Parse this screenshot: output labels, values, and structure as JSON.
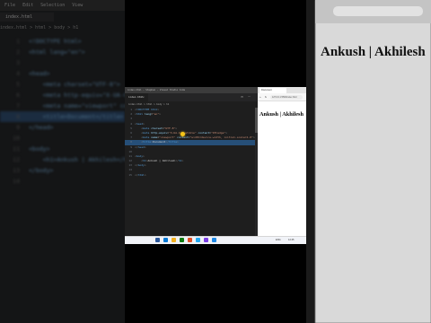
{
  "editor": {
    "title": "index.html - Stephen - Visual Studio Code",
    "tab_label": "index.html",
    "tab_close": "×",
    "breadcrumb": "index.html > html > body > h1",
    "menu": [
      "File",
      "Edit",
      "Selection",
      "View"
    ],
    "code_lines": [
      {
        "n": "1",
        "html": "<span class='p'>&lt;</span><span class='t'>!DOCTYPE html</span><span class='p'>&gt;</span>"
      },
      {
        "n": "2",
        "html": "<span class='p'>&lt;</span><span class='t'>html</span> <span class='a'>lang</span><span class='x'>=</span><span class='s'>\"en\"</span><span class='p'>&gt;</span>"
      },
      {
        "n": "3",
        "html": ""
      },
      {
        "n": "4",
        "html": "<span class='p'>&lt;</span><span class='t'>head</span><span class='p'>&gt;</span>"
      },
      {
        "n": "5",
        "html": "    <span class='p'>&lt;</span><span class='t'>meta</span> <span class='a'>charset</span><span class='x'>=</span><span class='s'>\"UTF-8\"</span><span class='p'>&gt;</span>"
      },
      {
        "n": "6",
        "html": "    <span class='p'>&lt;</span><span class='t'>meta</span> <span class='a'>http-equiv</span><span class='x'>=</span><span class='s'>\"X-UA-Compatible\"</span> <span class='a'>content</span><span class='x'>=</span><span class='s'>\"IE=edge\"</span><span class='p'>&gt;</span>"
      },
      {
        "n": "7",
        "html": "    <span class='p'>&lt;</span><span class='t'>meta</span> <span class='a'>name</span><span class='x'>=</span><span class='s'>\"viewport\"</span> <span class='a'>content</span><span class='x'>=</span><span class='s'>\"width=device-width, initial-scale=1.0\"</span><span class='p'>&gt;</span>"
      },
      {
        "n": "8",
        "html": "    <span class='p'>&lt;</span><span class='t'>title</span><span class='p'>&gt;</span><span class='x'>Document</span><span class='p'>&lt;/</span><span class='t'>title</span><span class='p'>&gt;</span>",
        "hl": true
      },
      {
        "n": "9",
        "html": "<span class='p'>&lt;/</span><span class='t'>head</span><span class='p'>&gt;</span>"
      },
      {
        "n": "10",
        "html": ""
      },
      {
        "n": "11",
        "html": "<span class='p'>&lt;</span><span class='t'>body</span><span class='p'>&gt;</span>"
      },
      {
        "n": "12",
        "html": "    <span class='p'>&lt;</span><span class='t'>h1</span><span class='p'>&gt;</span><span class='x'>Ankush | Akhilesh</span><span class='p'>&lt;/</span><span class='t'>h1</span><span class='p'>&gt;</span>"
      },
      {
        "n": "13",
        "html": "<span class='p'>&lt;/</span><span class='t'>body</span><span class='p'>&gt;</span>"
      },
      {
        "n": "14",
        "html": ""
      },
      {
        "n": "15",
        "html": "<span class='p'>&lt;/</span><span class='t'>html</span><span class='p'>&gt;</span>"
      }
    ]
  },
  "browser": {
    "tab_title": "Document",
    "address": "127.0.0.1:5500/index.html",
    "heading": "Ankush | Akhilesh"
  },
  "taskbar": {
    "sys": "ENG",
    "time": "12:45",
    "icons": [
      "#2b579a",
      "#0078d4",
      "#f2b01e",
      "#0f7b0f",
      "#e34f26",
      "#23a9f2",
      "#7b3fe4",
      "#1e88e5"
    ]
  },
  "colors": {
    "editor_bg": "#1e1e1e",
    "keyword": "#569cd6",
    "attribute": "#9cdcfe",
    "string": "#ce9178",
    "selection": "#264f78"
  }
}
